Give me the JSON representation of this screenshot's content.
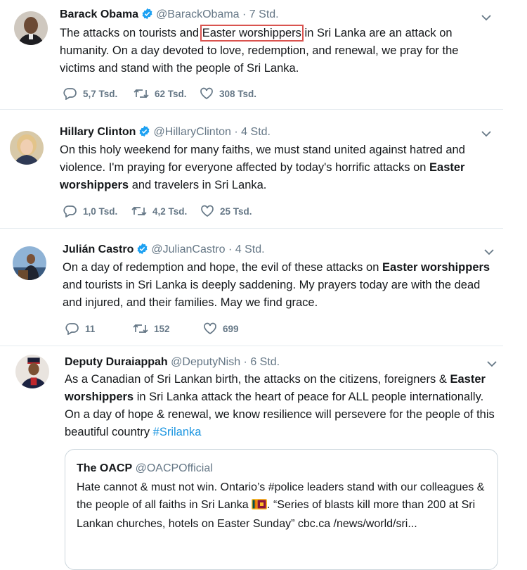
{
  "tweets": [
    {
      "name": "Barack Obama",
      "handle": "@BarackObama",
      "time": "· 7 Std.",
      "text_pre": "The attacks on tourists and ",
      "text_hl": "Easter worshippers",
      "text_post": " in Sri Lanka are an attack on humanity. On a day devoted to love, redemption, and renewal, we pray for the victims and stand with the people of Sri Lanka.",
      "replies": "5,7 Tsd.",
      "retweets": "62 Tsd.",
      "likes": "308 Tsd."
    },
    {
      "name": "Hillary Clinton",
      "handle": "@HillaryClinton",
      "time": "· 4 Std.",
      "text_pre": "On this holy weekend for many faiths, we must stand united against hatred and violence. I'm praying for everyone affected by today's horrific attacks on ",
      "text_bold": "Easter worshippers",
      "text_post": " and travelers in Sri Lanka.",
      "replies": "1,0 Tsd.",
      "retweets": "4,2 Tsd.",
      "likes": "25 Tsd."
    },
    {
      "name": "Julián Castro",
      "handle": "@JulianCastro",
      "time": "· 4 Std.",
      "text_pre": "On a day of redemption and hope, the evil of these attacks on ",
      "text_bold": "Easter worshippers",
      "text_post": " and tourists in Sri Lanka is deeply saddening. My prayers today are with the dead and injured, and their families. May we find grace.",
      "replies": "11",
      "retweets": "152",
      "likes": "699"
    },
    {
      "name": "Deputy Duraiappah",
      "handle": "@DeputyNish",
      "time": "· 6 Std.",
      "text_pre": "As a Canadian of Sri Lankan birth, the attacks on the citizens, foreigners & ",
      "text_bold": "Easter worshippers",
      "text_post": " in Sri Lanka attack the heart of peace for ALL people internationally. On a day of hope & renewal, we know resilience will persevere for the people of this beautiful country ",
      "hashtag": "#Srilanka",
      "quote": {
        "name": "The OACP",
        "handle": "@OACPOfficial",
        "text_pre": "Hate cannot & must not win. Ontario’s #police leaders stand with our colleagues & the people of all faiths in Sri Lanka ",
        "text_post": ". “Series of blasts kill more than 200 at Sri Lankan churches, hotels on Easter Sunday” cbc.ca /news/world/sri..."
      }
    }
  ],
  "icons": {
    "reply": "reply-icon",
    "retweet": "retweet-icon",
    "like": "heart-icon",
    "verified": "verified-badge-icon",
    "more": "chevron-down-icon",
    "flag": "sri-lanka-flag-icon"
  },
  "colors": {
    "text": "#14171a",
    "muted": "#657786",
    "link": "#1b95e0",
    "verified": "#1da1f2",
    "highlight_box": "#d9534f"
  }
}
